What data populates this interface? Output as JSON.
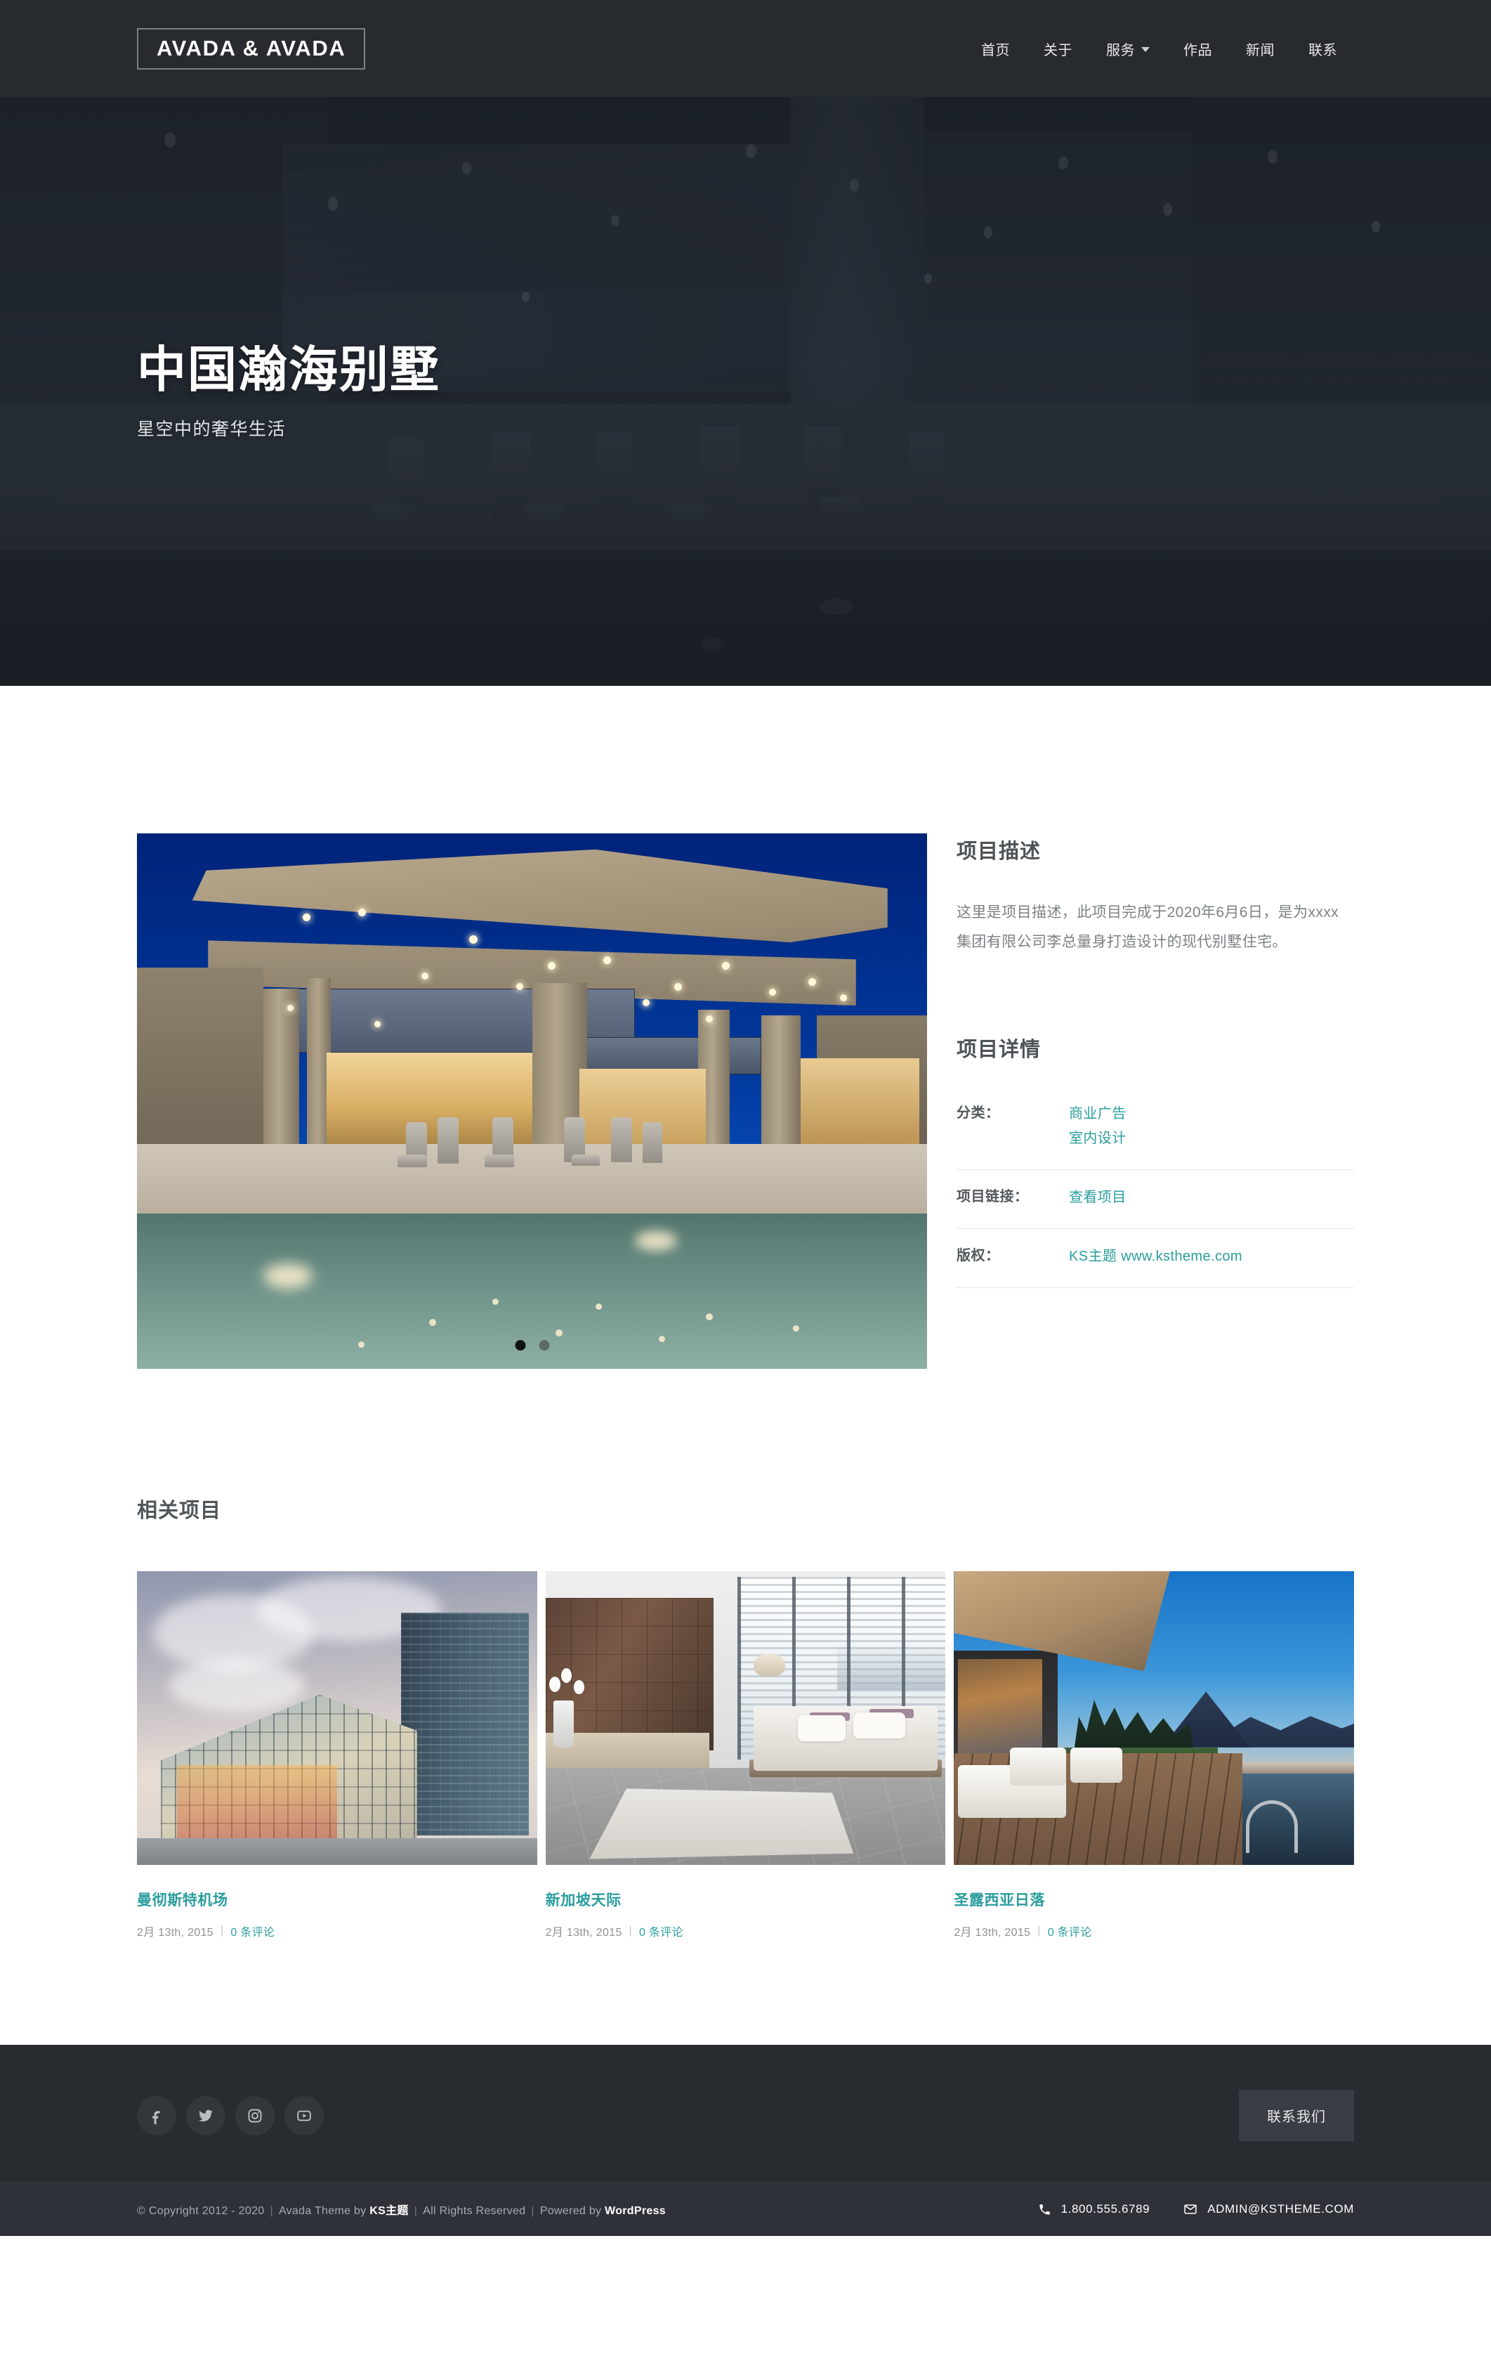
{
  "header": {
    "logo": "AVADA & AVADA",
    "nav": [
      {
        "label": "首页",
        "has_dropdown": false
      },
      {
        "label": "关于",
        "has_dropdown": false
      },
      {
        "label": "服务",
        "has_dropdown": true
      },
      {
        "label": "作品",
        "has_dropdown": false
      },
      {
        "label": "新闻",
        "has_dropdown": false
      },
      {
        "label": "联系",
        "has_dropdown": false
      }
    ]
  },
  "hero": {
    "title": "中国瀚海别墅",
    "subtitle": "星空中的奢华生活",
    "background_description": "dark-villa-interior-patio-photo",
    "overlay_color": "#1a1f27"
  },
  "project": {
    "gallery": {
      "image_description": "modern-villa-twilight-pool",
      "slides": 2,
      "active_slide": 1
    },
    "description_heading": "项目描述",
    "description_body": "这里是项目描述，此项目完成于2020年6月6日，是为xxxx集团有限公司李总量身打造设计的现代别墅住宅。",
    "details_heading": "项目详情",
    "details": [
      {
        "key": "分类：",
        "values": [
          "商业广告",
          "室内设计"
        ]
      },
      {
        "key": "项目链接：",
        "values": [
          "查看项目"
        ]
      },
      {
        "key": "版权：",
        "values": [
          "KS主题 www.kstheme.com"
        ]
      }
    ]
  },
  "related": {
    "heading": "相关项目",
    "items": [
      {
        "title": "曼彻斯特机场",
        "date": "2月 13th, 2015",
        "comments": "0 条评论",
        "separator": "|",
        "image_description": "modern-glass-office-building"
      },
      {
        "title": "新加坡天际",
        "date": "2月 13th, 2015",
        "comments": "0 条评论",
        "separator": "|",
        "image_description": "modern-bedroom-city-view"
      },
      {
        "title": "圣露西亚日落",
        "date": "2月 13th, 2015",
        "comments": "0 条评论",
        "separator": "|",
        "image_description": "infinity-pool-sunset-terrace"
      }
    ]
  },
  "footer": {
    "socials": [
      "facebook-icon",
      "twitter-icon",
      "instagram-icon",
      "youtube-icon"
    ],
    "contact_button": "联系我们",
    "copyright_prefix": "© Copyright 2012 - 2020",
    "theme_by": "Avada Theme by",
    "theme_author": "KS主题",
    "rights": "All Rights Reserved",
    "powered_prefix": "Powered by",
    "powered_by": "WordPress",
    "phone": "1.800.555.6789",
    "email": "ADMIN@KSTHEME.COM"
  },
  "colors": {
    "header_bg": "#272a2f",
    "accent_teal": "#2a9d9d",
    "footer_bg": "#282b30",
    "copybar_bg": "#2e3238",
    "body_text": "#7b8285"
  }
}
